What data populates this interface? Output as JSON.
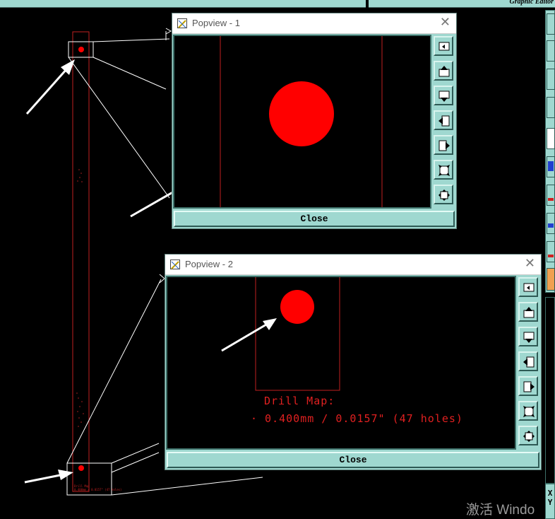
{
  "top_bar": {
    "right_title": "Graphic Editor"
  },
  "popview1": {
    "title": "Popview - 1",
    "close_label": "Close"
  },
  "popview2": {
    "title": "Popview - 2",
    "close_label": "Close",
    "drill_map_label": "Drill Map:",
    "drill_map_entry": "· 0.400mm / 0.0157\" (47 holes)"
  },
  "right_panel": {
    "xy_label_x": "X",
    "xy_label_y": "Y"
  },
  "watermark": "激活 Windo",
  "toolbar_icons": [
    "zoom-fit-icon",
    "pan-up-icon",
    "pan-down-icon",
    "pan-left-icon",
    "pan-right-icon",
    "zoom-out-icon",
    "zoom-in-icon"
  ],
  "colors": {
    "panel": "#9fd8d0",
    "trace": "#e02020",
    "pad": "#ff0000",
    "background": "#000000"
  }
}
